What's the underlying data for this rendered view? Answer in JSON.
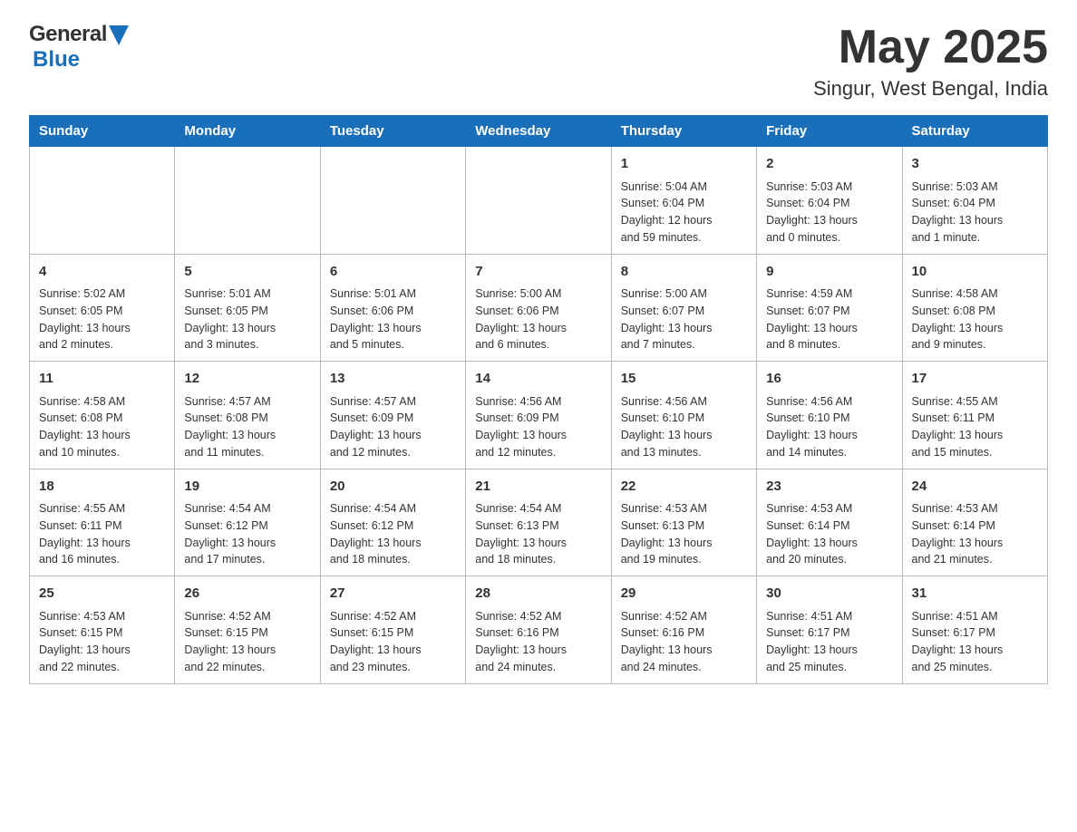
{
  "header": {
    "logo_general": "General",
    "logo_blue": "Blue",
    "month_title": "May 2025",
    "location": "Singur, West Bengal, India"
  },
  "weekdays": [
    "Sunday",
    "Monday",
    "Tuesday",
    "Wednesday",
    "Thursday",
    "Friday",
    "Saturday"
  ],
  "rows": [
    [
      {
        "day": "",
        "info": ""
      },
      {
        "day": "",
        "info": ""
      },
      {
        "day": "",
        "info": ""
      },
      {
        "day": "",
        "info": ""
      },
      {
        "day": "1",
        "info": "Sunrise: 5:04 AM\nSunset: 6:04 PM\nDaylight: 12 hours\nand 59 minutes."
      },
      {
        "day": "2",
        "info": "Sunrise: 5:03 AM\nSunset: 6:04 PM\nDaylight: 13 hours\nand 0 minutes."
      },
      {
        "day": "3",
        "info": "Sunrise: 5:03 AM\nSunset: 6:04 PM\nDaylight: 13 hours\nand 1 minute."
      }
    ],
    [
      {
        "day": "4",
        "info": "Sunrise: 5:02 AM\nSunset: 6:05 PM\nDaylight: 13 hours\nand 2 minutes."
      },
      {
        "day": "5",
        "info": "Sunrise: 5:01 AM\nSunset: 6:05 PM\nDaylight: 13 hours\nand 3 minutes."
      },
      {
        "day": "6",
        "info": "Sunrise: 5:01 AM\nSunset: 6:06 PM\nDaylight: 13 hours\nand 5 minutes."
      },
      {
        "day": "7",
        "info": "Sunrise: 5:00 AM\nSunset: 6:06 PM\nDaylight: 13 hours\nand 6 minutes."
      },
      {
        "day": "8",
        "info": "Sunrise: 5:00 AM\nSunset: 6:07 PM\nDaylight: 13 hours\nand 7 minutes."
      },
      {
        "day": "9",
        "info": "Sunrise: 4:59 AM\nSunset: 6:07 PM\nDaylight: 13 hours\nand 8 minutes."
      },
      {
        "day": "10",
        "info": "Sunrise: 4:58 AM\nSunset: 6:08 PM\nDaylight: 13 hours\nand 9 minutes."
      }
    ],
    [
      {
        "day": "11",
        "info": "Sunrise: 4:58 AM\nSunset: 6:08 PM\nDaylight: 13 hours\nand 10 minutes."
      },
      {
        "day": "12",
        "info": "Sunrise: 4:57 AM\nSunset: 6:08 PM\nDaylight: 13 hours\nand 11 minutes."
      },
      {
        "day": "13",
        "info": "Sunrise: 4:57 AM\nSunset: 6:09 PM\nDaylight: 13 hours\nand 12 minutes."
      },
      {
        "day": "14",
        "info": "Sunrise: 4:56 AM\nSunset: 6:09 PM\nDaylight: 13 hours\nand 12 minutes."
      },
      {
        "day": "15",
        "info": "Sunrise: 4:56 AM\nSunset: 6:10 PM\nDaylight: 13 hours\nand 13 minutes."
      },
      {
        "day": "16",
        "info": "Sunrise: 4:56 AM\nSunset: 6:10 PM\nDaylight: 13 hours\nand 14 minutes."
      },
      {
        "day": "17",
        "info": "Sunrise: 4:55 AM\nSunset: 6:11 PM\nDaylight: 13 hours\nand 15 minutes."
      }
    ],
    [
      {
        "day": "18",
        "info": "Sunrise: 4:55 AM\nSunset: 6:11 PM\nDaylight: 13 hours\nand 16 minutes."
      },
      {
        "day": "19",
        "info": "Sunrise: 4:54 AM\nSunset: 6:12 PM\nDaylight: 13 hours\nand 17 minutes."
      },
      {
        "day": "20",
        "info": "Sunrise: 4:54 AM\nSunset: 6:12 PM\nDaylight: 13 hours\nand 18 minutes."
      },
      {
        "day": "21",
        "info": "Sunrise: 4:54 AM\nSunset: 6:13 PM\nDaylight: 13 hours\nand 18 minutes."
      },
      {
        "day": "22",
        "info": "Sunrise: 4:53 AM\nSunset: 6:13 PM\nDaylight: 13 hours\nand 19 minutes."
      },
      {
        "day": "23",
        "info": "Sunrise: 4:53 AM\nSunset: 6:14 PM\nDaylight: 13 hours\nand 20 minutes."
      },
      {
        "day": "24",
        "info": "Sunrise: 4:53 AM\nSunset: 6:14 PM\nDaylight: 13 hours\nand 21 minutes."
      }
    ],
    [
      {
        "day": "25",
        "info": "Sunrise: 4:53 AM\nSunset: 6:15 PM\nDaylight: 13 hours\nand 22 minutes."
      },
      {
        "day": "26",
        "info": "Sunrise: 4:52 AM\nSunset: 6:15 PM\nDaylight: 13 hours\nand 22 minutes."
      },
      {
        "day": "27",
        "info": "Sunrise: 4:52 AM\nSunset: 6:15 PM\nDaylight: 13 hours\nand 23 minutes."
      },
      {
        "day": "28",
        "info": "Sunrise: 4:52 AM\nSunset: 6:16 PM\nDaylight: 13 hours\nand 24 minutes."
      },
      {
        "day": "29",
        "info": "Sunrise: 4:52 AM\nSunset: 6:16 PM\nDaylight: 13 hours\nand 24 minutes."
      },
      {
        "day": "30",
        "info": "Sunrise: 4:51 AM\nSunset: 6:17 PM\nDaylight: 13 hours\nand 25 minutes."
      },
      {
        "day": "31",
        "info": "Sunrise: 4:51 AM\nSunset: 6:17 PM\nDaylight: 13 hours\nand 25 minutes."
      }
    ]
  ]
}
